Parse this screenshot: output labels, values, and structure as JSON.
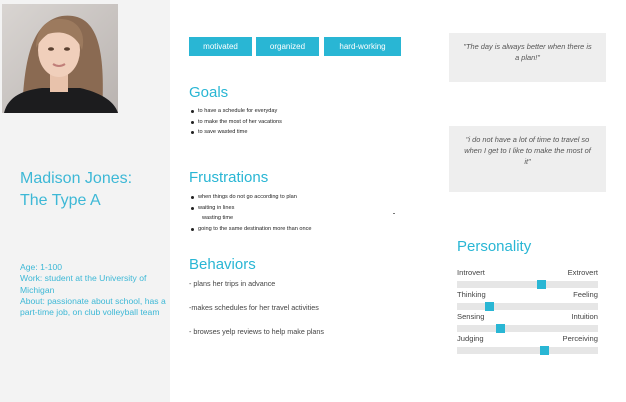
{
  "persona": {
    "name_line1": "Madison Jones:",
    "name_line2": "The Type A",
    "age": "Age: 1-100",
    "work": "Work: student at the University of Michigan",
    "about": "About: passionate about school, has a part-time job, on club volleyball team"
  },
  "tags": [
    "motivated",
    "organized",
    "hard-working"
  ],
  "goals": {
    "title": "Goals",
    "items": [
      "to have a schedule for everyday",
      "to make the most of her vacations",
      "to save wasted time"
    ]
  },
  "frustrations": {
    "title": "Frustrations",
    "items": [
      "when things do not go according to plan",
      "waiting in lines",
      "wasting time",
      "going to the same destination more than once"
    ]
  },
  "behaviors": {
    "title": "Behaviors",
    "items": [
      "- plans her trips in advance",
      "-makes schedules for her travel activities",
      "- browses yelp reviews to help make plans"
    ]
  },
  "quotes": [
    "\"The day is always better when there is a plan!\"",
    "\"i do not have a lot of time to travel so when I get to I like to make the most of it\""
  ],
  "personality": {
    "title": "Personality",
    "traits": [
      {
        "left": "Introvert",
        "right": "Extrovert",
        "value": 0.6
      },
      {
        "left": "Thinking",
        "right": "Feeling",
        "value": 0.23
      },
      {
        "left": "Sensing",
        "right": "Intuition",
        "value": 0.31
      },
      {
        "left": "Judging",
        "right": "Perceiving",
        "value": 0.62
      }
    ]
  },
  "colors": {
    "accent": "#29b6d4",
    "panel": "#f3f3f3"
  }
}
